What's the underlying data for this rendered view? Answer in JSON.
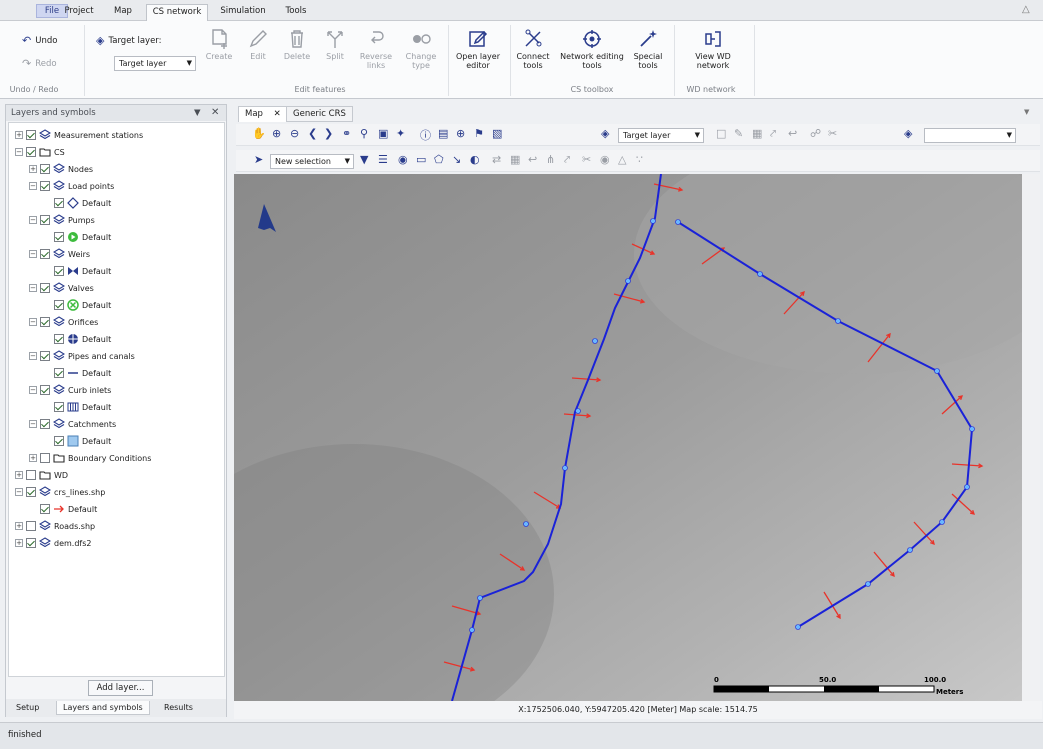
{
  "menu_tabs": [
    "File",
    "Project",
    "Map",
    "CS network",
    "Simulation",
    "Tools"
  ],
  "ribbon": {
    "undo": "Undo",
    "redo": "Redo",
    "undo_group": "Undo / Redo",
    "target_layer_label": "Target layer:",
    "target_layer_value": "Target layer",
    "create": "Create",
    "edit": "Edit",
    "delete": "Delete",
    "split": "Split",
    "reverse_links": "Reverse links",
    "change_type": "Change type",
    "edit_features_group": "Edit features",
    "open_layer_editor": "Open layer editor",
    "connect_tools": "Connect tools",
    "network_editing_tools": "Network editing tools",
    "special_tools": "Special tools",
    "cs_toolbox_group": "CS toolbox",
    "view_wd_network": "View WD network",
    "wd_network_group": "WD network"
  },
  "left_panel": {
    "title": "Layers and symbols",
    "add_layer": "Add layer...",
    "bottom_tabs": [
      "Setup",
      "Layers and symbols",
      "Results"
    ],
    "tree": [
      {
        "label": "Measurement stations",
        "level": 0,
        "checked": true,
        "icon": "layers"
      },
      {
        "label": "CS",
        "level": 0,
        "checked": true,
        "icon": "folder"
      },
      {
        "label": "Nodes",
        "level": 1,
        "checked": true,
        "icon": "layers"
      },
      {
        "label": "Load points",
        "level": 1,
        "checked": true,
        "icon": "layers"
      },
      {
        "label": "Default",
        "level": 2,
        "checked": true,
        "icon": "diamond"
      },
      {
        "label": "Pumps",
        "level": 1,
        "checked": true,
        "icon": "layers"
      },
      {
        "label": "Default",
        "level": 2,
        "checked": true,
        "icon": "pump"
      },
      {
        "label": "Weirs",
        "level": 1,
        "checked": true,
        "icon": "layers"
      },
      {
        "label": "Default",
        "level": 2,
        "checked": true,
        "icon": "weir"
      },
      {
        "label": "Valves",
        "level": 1,
        "checked": true,
        "icon": "layers"
      },
      {
        "label": "Default",
        "level": 2,
        "checked": true,
        "icon": "valve"
      },
      {
        "label": "Orifices",
        "level": 1,
        "checked": true,
        "icon": "layers"
      },
      {
        "label": "Default",
        "level": 2,
        "checked": true,
        "icon": "orifice"
      },
      {
        "label": "Pipes and canals",
        "level": 1,
        "checked": true,
        "icon": "layers"
      },
      {
        "label": "Default",
        "level": 2,
        "checked": true,
        "icon": "pipe"
      },
      {
        "label": "Curb inlets",
        "level": 1,
        "checked": true,
        "icon": "layers"
      },
      {
        "label": "Default",
        "level": 2,
        "checked": true,
        "icon": "curb"
      },
      {
        "label": "Catchments",
        "level": 1,
        "checked": true,
        "icon": "layers"
      },
      {
        "label": "Default",
        "level": 2,
        "checked": true,
        "icon": "catchment"
      },
      {
        "label": "Boundary Conditions",
        "level": 1,
        "checked": false,
        "icon": "folder"
      },
      {
        "label": "WD",
        "level": 0,
        "checked": false,
        "icon": "folder"
      },
      {
        "label": "crs_lines.shp",
        "level": 0,
        "checked": true,
        "icon": "layers"
      },
      {
        "label": "Default",
        "level": 1,
        "checked": true,
        "icon": "arrow"
      },
      {
        "label": "Roads.shp",
        "level": 0,
        "checked": false,
        "icon": "layers"
      },
      {
        "label": "dem.dfs2",
        "level": 0,
        "checked": true,
        "icon": "layers"
      }
    ]
  },
  "doc_tabs": [
    "Map",
    "Generic CRS"
  ],
  "map_toolbar": {
    "target_layer": "Target layer",
    "new_selection": "New selection"
  },
  "scale_bar": {
    "labels": [
      "0",
      "50.0",
      "100.0"
    ],
    "unit": "Meters"
  },
  "map_status": "X:1752506.040, Y:5947205.420 [Meter]   Map scale: 1514.75",
  "app_status": "finished",
  "colors": {
    "network_line": "#1a22d8",
    "node": "#6ab7ff",
    "crs_arrow": "#e8332a",
    "accent": "#2a3c8c"
  }
}
